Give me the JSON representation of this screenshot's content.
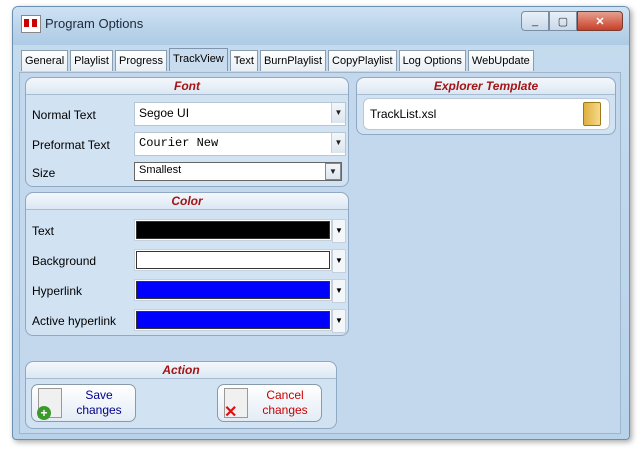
{
  "window": {
    "title": "Program Options"
  },
  "tabs": [
    "General",
    "Playlist",
    "Progress",
    "TrackView",
    "Text",
    "BurnPlaylist",
    "CopyPlaylist",
    "Log Options",
    "WebUpdate"
  ],
  "font_group": {
    "title": "Font",
    "rows": [
      {
        "label": "Normal Text",
        "value": "Segoe UI"
      },
      {
        "label": "Preformat Text",
        "value": "Courier New"
      },
      {
        "label": "Size",
        "value": "Smallest"
      }
    ]
  },
  "color_group": {
    "title": "Color",
    "rows": [
      {
        "label": "Text",
        "color": "#000000"
      },
      {
        "label": "Background",
        "color": "#ffffff"
      },
      {
        "label": "Hyperlink",
        "color": "#0000ff"
      },
      {
        "label": "Active hyperlink",
        "color": "#0000ff"
      }
    ]
  },
  "explorer_group": {
    "title": "Explorer Template",
    "value": "TrackList.xsl"
  },
  "action_group": {
    "title": "Action",
    "save_line1": "Save",
    "save_line2": "changes",
    "cancel_line1": "Cancel",
    "cancel_line2": "changes"
  },
  "colors": {
    "title_accent": "#a31515",
    "save_text": "#00008b",
    "cancel_text": "#cc0000"
  }
}
